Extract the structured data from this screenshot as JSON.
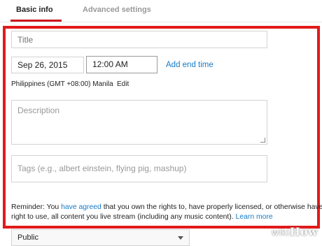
{
  "tabs": [
    {
      "label": "Basic info",
      "active": true
    },
    {
      "label": "Advanced settings",
      "active": false
    }
  ],
  "form": {
    "title_placeholder": "Title",
    "date_value": "Sep 26, 2015",
    "time_value": "12:00 AM",
    "add_end_time": "Add end time",
    "timezone": "Philippines (GMT +08:00) Manila",
    "timezone_edit": "Edit",
    "description_placeholder": "Description",
    "tags_placeholder": "Tags (e.g., albert einstein, flying pig, mashup)"
  },
  "reminder": {
    "prefix": "Reminder: You ",
    "agreed_link": "have agreed",
    "middle": " that you own the rights to, have properly licensed, or otherwise have",
    "line2": "right to use, all content you live stream (including any music content). ",
    "learn_more": "Learn more"
  },
  "privacy": {
    "selected": "Public"
  },
  "watermark": {
    "wiki": "wiki",
    "how": "How"
  },
  "colors": {
    "accent": "#cc181e",
    "highlight": "#e21a1a",
    "link": "#167ac6"
  }
}
